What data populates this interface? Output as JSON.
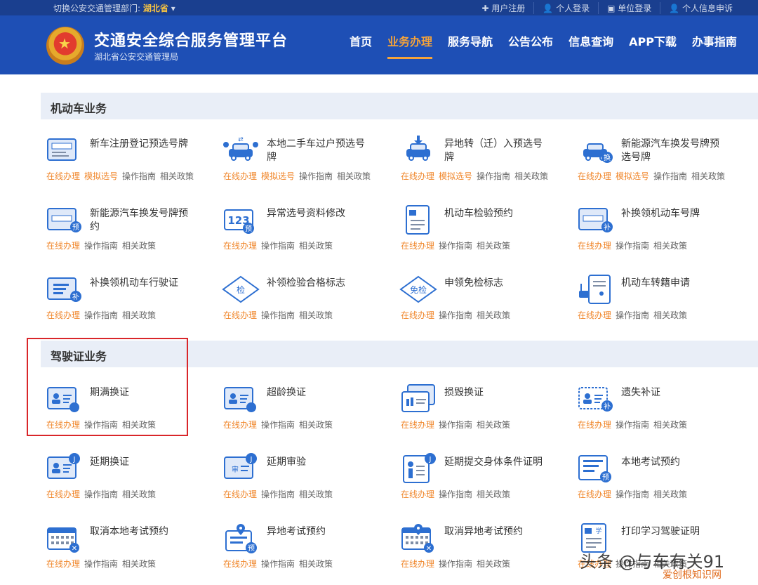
{
  "topbar": {
    "dept_label": "切换公安交通管理部门:",
    "dept_value": "湖北省",
    "links": [
      "✚ 用户注册",
      "👤 个人登录",
      "▣ 单位登录",
      "👤 个人信息申诉"
    ]
  },
  "header": {
    "title": "交通安全综合服务管理平台",
    "subtitle": "湖北省公安交通管理局",
    "nav": [
      "首页",
      "业务办理",
      "服务导航",
      "公告公布",
      "信息查询",
      "APP下载",
      "办事指南"
    ],
    "active_nav": "业务办理"
  },
  "sections": {
    "vehicle": {
      "title": "机动车业务"
    },
    "license": {
      "title": "驾驶证业务"
    }
  },
  "actions": {
    "online": "在线办理",
    "sim": "模拟选号",
    "guide": "操作指南",
    "policy": "相关政策"
  },
  "vehicle_items": [
    {
      "name": "新车注册登记预选号牌",
      "sim": true
    },
    {
      "name": "本地二手车过户预选号牌",
      "sim": true
    },
    {
      "name": "异地转（迁）入预选号牌",
      "sim": true
    },
    {
      "name": "新能源汽车换发号牌预选号牌",
      "sim": true
    },
    {
      "name": "新能源汽车换发号牌预约",
      "sim": false
    },
    {
      "name": "异常选号资料修改",
      "sim": false
    },
    {
      "name": "机动车检验预约",
      "sim": false
    },
    {
      "name": "补换领机动车号牌",
      "sim": false
    },
    {
      "name": "补换领机动车行驶证",
      "sim": false
    },
    {
      "name": "补领检验合格标志",
      "sim": false
    },
    {
      "name": "申领免检标志",
      "sim": false
    },
    {
      "name": "机动车转籍申请",
      "sim": false
    }
  ],
  "license_items": [
    {
      "name": "期满换证"
    },
    {
      "name": "超龄换证"
    },
    {
      "name": "损毁换证"
    },
    {
      "name": "遗失补证"
    },
    {
      "name": "延期换证"
    },
    {
      "name": "延期审验"
    },
    {
      "name": "延期提交身体条件证明"
    },
    {
      "name": "本地考试预约"
    },
    {
      "name": "取消本地考试预约"
    },
    {
      "name": "异地考试预约"
    },
    {
      "name": "取消异地考试预约"
    },
    {
      "name": "打印学习驾驶证明"
    }
  ],
  "icon_names": [
    "plate-icon",
    "people-car-icon",
    "transfer-car-icon",
    "ev-car-icon",
    "plate-reserve-icon",
    "number-123-icon",
    "inspection-doc-icon",
    "plate-replace-icon",
    "license-replace-icon",
    "check-diamond-icon",
    "exempt-diamond-icon",
    "transfer-doc-icon",
    "id-card-clock-icon",
    "id-card-clock-icon",
    "id-card-damaged-icon",
    "id-card-lost-icon",
    "id-card-j-icon",
    "review-card-j-icon",
    "person-doc-j-icon",
    "exam-doc-icon",
    "calendar-cancel-icon",
    "location-doc-icon",
    "calendar-location-cancel-icon",
    "learner-doc-icon"
  ],
  "watermark": "头条 @与车有关91",
  "watermark2": "爱创根知识网",
  "colors": {
    "header": "#1e4fb5",
    "topbar": "#1a3f8f",
    "accent": "#f0862a",
    "highlight": "#d9262a"
  }
}
